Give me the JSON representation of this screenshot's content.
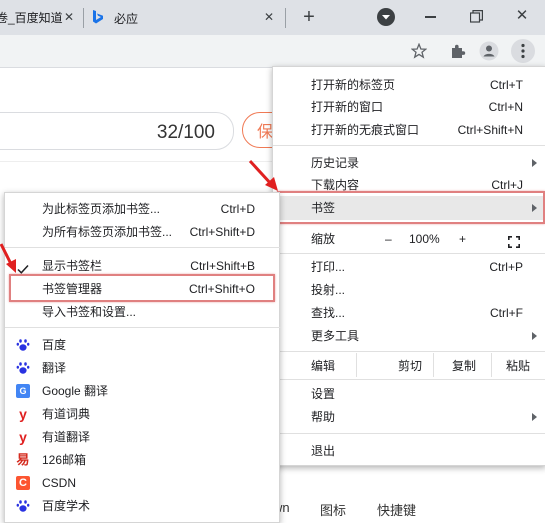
{
  "tabs": [
    {
      "title": "卷_百度知道"
    },
    {
      "title": "必应"
    }
  ],
  "toolbar": {
    "icons": [
      "star-icon",
      "extensions-icon",
      "profile-icon",
      "menu-icon"
    ]
  },
  "page": {
    "counter": "32/100",
    "button_fragment": "保",
    "bottom_links": [
      "wn",
      "图标",
      "快捷键"
    ]
  },
  "main_menu": {
    "new_tab": {
      "label": "打开新的标签页",
      "shortcut": "Ctrl+T"
    },
    "new_window": {
      "label": "打开新的窗口",
      "shortcut": "Ctrl+N"
    },
    "incognito": {
      "label": "打开新的无痕式窗口",
      "shortcut": "Ctrl+Shift+N"
    },
    "history": {
      "label": "历史记录"
    },
    "downloads": {
      "label": "下载内容",
      "shortcut": "Ctrl+J"
    },
    "bookmarks": {
      "label": "书签"
    },
    "zoom": {
      "label": "缩放",
      "minus": "–",
      "value": "100%",
      "plus": "+"
    },
    "print": {
      "label": "打印...",
      "shortcut": "Ctrl+P"
    },
    "cast": {
      "label": "投射..."
    },
    "find": {
      "label": "查找...",
      "shortcut": "Ctrl+F"
    },
    "more_tools": {
      "label": "更多工具"
    },
    "edit": {
      "label": "编辑",
      "cut": "剪切",
      "copy": "复制",
      "paste": "粘贴"
    },
    "settings": {
      "label": "设置"
    },
    "help": {
      "label": "帮助"
    },
    "exit": {
      "label": "退出"
    }
  },
  "bookmarks_menu": {
    "add_this": {
      "label": "为此标签页添加书签...",
      "shortcut": "Ctrl+D"
    },
    "add_all": {
      "label": "为所有标签页添加书签...",
      "shortcut": "Ctrl+Shift+D"
    },
    "show_bar": {
      "label": "显示书签栏",
      "shortcut": "Ctrl+Shift+B",
      "checked": true
    },
    "manager": {
      "label": "书签管理器",
      "shortcut": "Ctrl+Shift+O"
    },
    "import": {
      "label": "导入书签和设置..."
    },
    "bookmarks": [
      {
        "label": "百度",
        "icon": "baidu-icon",
        "color": "#2932e1"
      },
      {
        "label": "翻译",
        "icon": "baidu-icon",
        "color": "#2932e1"
      },
      {
        "label": "Google 翻译",
        "icon": "google-translate-icon",
        "color": "#4285f4"
      },
      {
        "label": "有道词典",
        "icon": "youdao-icon",
        "color": "#e02020"
      },
      {
        "label": "有道翻译",
        "icon": "youdao-icon",
        "color": "#e02020"
      },
      {
        "label": "126邮箱",
        "icon": "mail126-icon",
        "color": "#d42a1e"
      },
      {
        "label": "CSDN",
        "icon": "csdn-icon",
        "color": "#fc5531"
      },
      {
        "label": "百度学术",
        "icon": "baidu-icon",
        "color": "#2932e1"
      }
    ]
  },
  "colors": {
    "highlight_box": "#e08080",
    "arrow": "#e02020"
  }
}
